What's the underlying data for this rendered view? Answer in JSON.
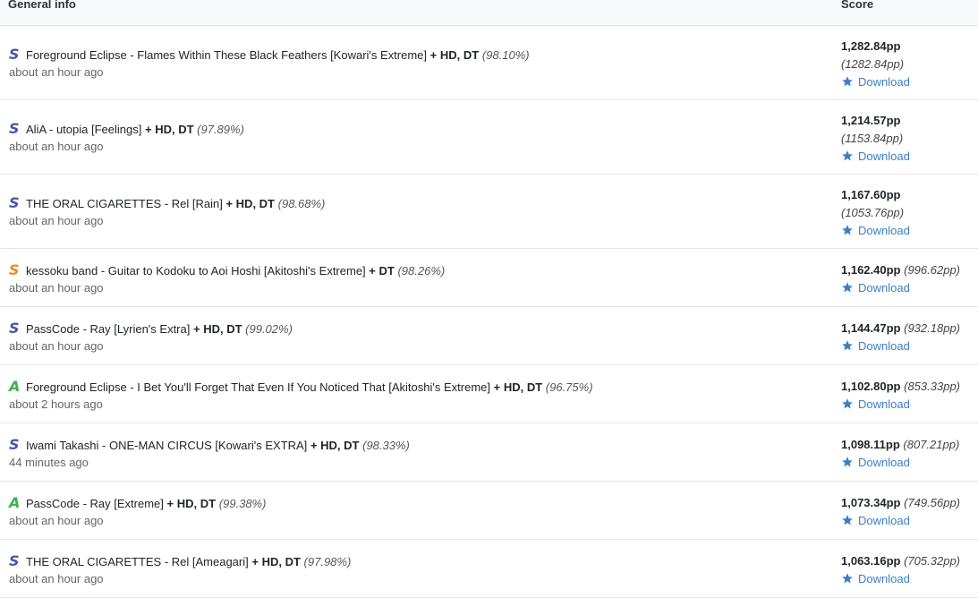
{
  "header": {
    "col_info": "General info",
    "col_score": "Score"
  },
  "colors": {
    "grade_S": "#4455aa",
    "grade_SH": "#f08a24",
    "grade_A": "#3bb34a",
    "link": "#3a7ec7"
  },
  "download_label": "Download",
  "download_icon": "star-icon",
  "scores": [
    {
      "grade": "S",
      "grade_type": "S",
      "title": "Foreground Eclipse - Flames Within These Black Feathers [Kowari's Extreme]",
      "mods": "+ HD, DT",
      "accuracy": "(98.10%)",
      "time": "about an hour ago",
      "pp": "1,282.84pp",
      "pp_weighted": "(1282.84pp)",
      "layout": "tall"
    },
    {
      "grade": "S",
      "grade_type": "S",
      "title": "AliA - utopia [Feelings]",
      "mods": "+ HD, DT",
      "accuracy": "(97.89%)",
      "time": "about an hour ago",
      "pp": "1,214.57pp",
      "pp_weighted": "(1153.84pp)",
      "layout": "tall"
    },
    {
      "grade": "S",
      "grade_type": "S",
      "title": "THE ORAL CIGARETTES - Rel [Rain]",
      "mods": "+ HD, DT",
      "accuracy": "(98.68%)",
      "time": "about an hour ago",
      "pp": "1,167.60pp",
      "pp_weighted": "(1053.76pp)",
      "layout": "tall"
    },
    {
      "grade": "S",
      "grade_type": "SH",
      "title": "kessoku band - Guitar to Kodoku to Aoi Hoshi [Akitoshi's Extreme]",
      "mods": "+ DT",
      "accuracy": "(98.26%)",
      "time": "about an hour ago",
      "pp": "1,162.40pp",
      "pp_weighted": "(996.62pp)",
      "layout": "short"
    },
    {
      "grade": "S",
      "grade_type": "S",
      "title": "PassCode - Ray [Lyrien's Extra]",
      "mods": "+ HD, DT",
      "accuracy": "(99.02%)",
      "time": "about an hour ago",
      "pp": "1,144.47pp",
      "pp_weighted": "(932.18pp)",
      "layout": "short"
    },
    {
      "grade": "A",
      "grade_type": "A",
      "title": "Foreground Eclipse - I Bet You'll Forget That Even If You Noticed That [Akitoshi's Extreme]",
      "mods": "+ HD, DT",
      "accuracy": "(96.75%)",
      "time": "about 2 hours ago",
      "pp": "1,102.80pp",
      "pp_weighted": "(853.33pp)",
      "layout": "short"
    },
    {
      "grade": "S",
      "grade_type": "S",
      "title": "Iwami Takashi - ONE-MAN CIRCUS [Kowari's EXTRA]",
      "mods": "+ HD, DT",
      "accuracy": "(98.33%)",
      "time": "44 minutes ago",
      "pp": "1,098.11pp",
      "pp_weighted": "(807.21pp)",
      "layout": "short"
    },
    {
      "grade": "A",
      "grade_type": "A",
      "title": "PassCode - Ray [Extreme]",
      "mods": "+ HD, DT",
      "accuracy": "(99.38%)",
      "time": "about an hour ago",
      "pp": "1,073.34pp",
      "pp_weighted": "(749.56pp)",
      "layout": "short"
    },
    {
      "grade": "S",
      "grade_type": "S",
      "title": "THE ORAL CIGARETTES - Rel [Ameagari]",
      "mods": "+ HD, DT",
      "accuracy": "(97.98%)",
      "time": "about an hour ago",
      "pp": "1,063.16pp",
      "pp_weighted": "(705.32pp)",
      "layout": "short"
    }
  ]
}
